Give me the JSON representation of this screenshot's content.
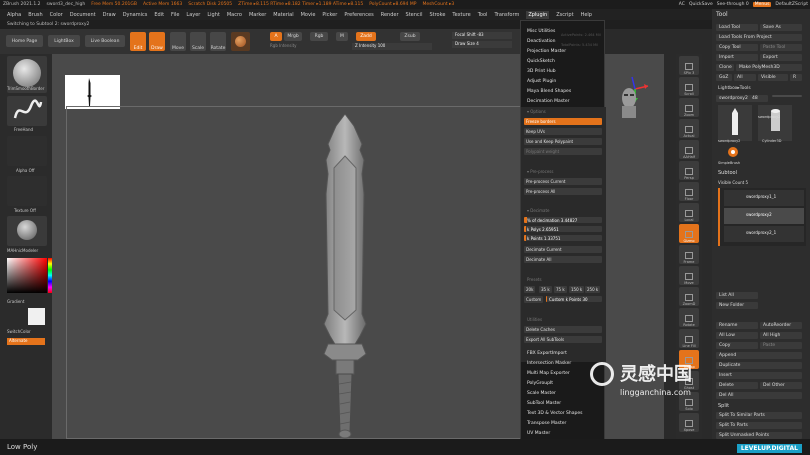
{
  "window": {
    "title": "ZBrush 2021.1.2",
    "doc": "sword3_dec_high",
    "stats": [
      "Free Mem 50.201GB",
      "Active Mem 1663",
      "Scratch Disk 20505",
      "ZTime ▸8.115 RTime ▸8.182 Timer ▸1.189 ATime ▸8.115",
      "PolyCount ▸8.694 MP",
      "MeshCount ▸3"
    ],
    "right": [
      "AC",
      "QuickSave",
      "See-through 0",
      "Menus",
      "DefaultZScript"
    ]
  },
  "menu": [
    "Alpha",
    "Brush",
    "Color",
    "Document",
    "Draw",
    "Dynamics",
    "Edit",
    "File",
    "Layer",
    "Light",
    "Macro",
    "Marker",
    "Material",
    "Movie",
    "Picker",
    "Preferences",
    "Render",
    "Stencil",
    "Stroke",
    "Texture",
    "Tool",
    "Transform",
    "Zplugin",
    "Zscript",
    "Help"
  ],
  "menu_active": "Zplugin",
  "subbar": "Switching to Subtool 2: swordproxy2",
  "toolbar": {
    "home": "Home Page",
    "lightbox": "LightBox",
    "liveboolean": "Live Boolean",
    "edit": "Edit",
    "draw": "Draw",
    "move": "Move",
    "scale": "Scale",
    "rotate": "Rotate",
    "a": "A",
    "mrgb": "Mrgb",
    "rgb": "Rgb",
    "m": "M",
    "zadd": "Zadd",
    "zsub": "Zsub",
    "rgb_intensity": "Rgb Intensity",
    "z_intensity": "Z Intensity 100",
    "focal": "Focal Shift -83",
    "drawsize": "Draw Size 4"
  },
  "left": {
    "brush": "TrimSmoothBorder",
    "stroke": "FreeHand",
    "alpha": "Alpha Off",
    "texture": "Texture Off",
    "material": "MAHnicModeler",
    "gradient": "Gradient",
    "switch": "SwitchColor",
    "alternate": "Alternate"
  },
  "dropdown": {
    "top": [
      "Misc Utilities",
      "Deactivation",
      "Projection Master",
      "QuickSketch",
      "3D Print Hub",
      "Adjust Plugin",
      "Maya Blend Shapes",
      "Decimation Master"
    ],
    "ghost": [
      "ActivePoints: 2.464 Mil",
      "TotalPoints: 5.434 Mil"
    ],
    "hdr_options": "▾ Options",
    "freeze": "Freeze borders",
    "keepuv": "Keep UVs",
    "keeppoly": "Use and Keep Polypaint",
    "polyweight": "Polypaint weight",
    "hdr_pre": "▾ Pre-process",
    "precurrent": "Pre-process Current",
    "preall": "Pre-process All",
    "hdr_dec": "▾ Decimate",
    "pct": "% of decimation 3.44827",
    "kpolys": "k Polys 2.65951",
    "kpoints": "k Points 1.33751",
    "deccurrent": "Decimate Current",
    "decall": "Decimate All",
    "hdr_presets": "Presets",
    "presets": [
      "20k",
      "35 k",
      "75 k",
      "150 k",
      "250 k"
    ],
    "custom": "Custom",
    "custompts": "Custom k Points 30",
    "hdr_util": "Utilities",
    "deletecaches": "Delete Caches",
    "exportall": "Export All SubTools",
    "bottom": [
      "FBX ExportImport",
      "Intersection Masker",
      "Multi Map Exporter",
      "PolyGroupIt",
      "Scale Master",
      "SubTool Master",
      "Text 3D & Vector Shapes",
      "Transpose Master",
      "UV Master"
    ]
  },
  "right_shelf": [
    "SPix 3",
    "Scroll",
    "Zoom",
    "Actual",
    "AAHalf",
    "Persp",
    "Floor",
    "Local",
    "Gizmo",
    "Frame",
    "Move",
    "ZoomD",
    "Rotate",
    "Line Fill",
    "Transp",
    "Ghost",
    "Solo",
    "Xpose"
  ],
  "tray": {
    "title": "Tool",
    "buttons": [
      "Load Tool",
      "Save As",
      "Load Tools From Project",
      "Copy Tool",
      "Paste Tool",
      "Import",
      "Export",
      "Clone",
      "Make PolyMesh3D",
      "GoZ",
      "All",
      "Visible",
      "R"
    ],
    "lightbox": "Lightbox▸Tools",
    "tool_name": "swordproxy2",
    "tool_count": "48",
    "thumbs": [
      "swordproxy2",
      "Cylinder3D",
      "swordproxy2",
      "SimpleBrush"
    ],
    "subtool_title": "Subtool",
    "visible": "Visible Count 5",
    "subtools": [
      "swordproxy1_1",
      "swordproxy2",
      "swordproxy2_1"
    ],
    "listall": "List All",
    "newfolder": "New Folder",
    "ops": [
      "Rename",
      "AutoReorder",
      "All Low",
      "All High",
      "Copy",
      "Paste",
      "Append",
      "Duplicate",
      "Insert",
      "Delete",
      "Del Other",
      "Del All"
    ],
    "split": "Split",
    "split_parts": "Split To Similar Parts",
    "split_to": "Split To Parts",
    "split_unmasked": "Split Unmasked Points"
  },
  "status": "Low Poly",
  "watermark": {
    "cn": "灵感中国",
    "url": "lingganchina.com",
    "badge": "LEVELUP.DIGITAL"
  },
  "colors": {
    "accent": "#e4731b",
    "canvas": "#4a4a4a",
    "panel": "#2d2d2d"
  }
}
